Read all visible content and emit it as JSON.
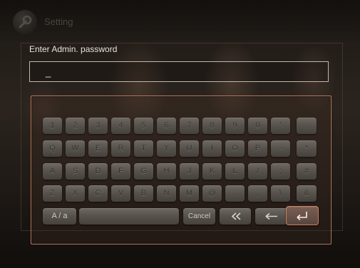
{
  "header": {
    "title": "Setting",
    "icon": "wrench-icon"
  },
  "prompt": "Enter Admin. password",
  "password": {
    "value": "_"
  },
  "keyboard": {
    "rows": [
      [
        "1",
        "2",
        "3",
        "4",
        "5",
        "6",
        "7",
        "8",
        "9",
        "0",
        "'",
        ":"
      ],
      [
        "Q",
        "W",
        "E",
        "R",
        "T",
        "Y",
        "U",
        "I",
        "O",
        "P",
        "-",
        "*"
      ],
      [
        "A",
        "S",
        "D",
        "F",
        "G",
        "H",
        "J",
        "K",
        "L",
        "/",
        ";",
        "#"
      ],
      [
        "Z",
        "X",
        "C",
        "V",
        "B",
        "N",
        "M",
        "@",
        ".",
        ",",
        "\\",
        "&"
      ]
    ],
    "bottom": {
      "case_toggle": "A / a",
      "cancel": "Cancel",
      "backspace_all_icon": "double-left-arrow-icon",
      "backspace_icon": "left-arrow-icon",
      "enter_icon": "enter-icon"
    }
  },
  "colors": {
    "accent": "#cc7d62",
    "key": "#5a554f"
  }
}
